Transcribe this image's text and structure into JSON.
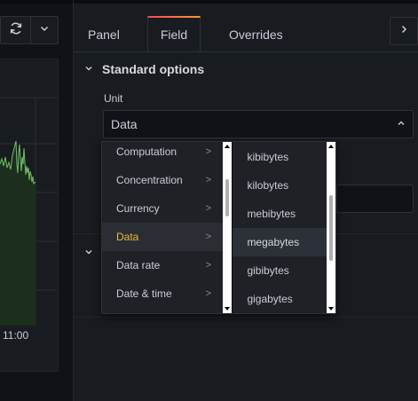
{
  "graph": {
    "time_label": "11:00"
  },
  "tabs": [
    {
      "label": "Panel"
    },
    {
      "label": "Field"
    },
    {
      "label": "Overrides"
    }
  ],
  "section": {
    "title": "Standard options"
  },
  "unit": {
    "label": "Unit",
    "value": "Data"
  },
  "cascader": {
    "categories": [
      {
        "label": "Computation",
        "arrow": ">"
      },
      {
        "label": "Concentration",
        "arrow": ">"
      },
      {
        "label": "Currency",
        "arrow": ">"
      },
      {
        "label": "Data",
        "arrow": ">"
      },
      {
        "label": "Data rate",
        "arrow": ">"
      },
      {
        "label": "Date & time",
        "arrow": ">"
      }
    ],
    "units": [
      {
        "label": "kibibytes"
      },
      {
        "label": "kilobytes"
      },
      {
        "label": "mebibytes"
      },
      {
        "label": "megabytes"
      },
      {
        "label": "gibibytes"
      },
      {
        "label": "gigabytes"
      }
    ]
  },
  "colors": {
    "active_text": "#eab839",
    "background": "#111217",
    "panel": "#181b1f",
    "graph_line": "#73bf69"
  },
  "icons": {
    "refresh": "refresh-icon",
    "dropdown": "chevron-down-icon",
    "expand": "chevron-right-icon",
    "select_open": "chevron-up-icon",
    "section_toggle": "chevron-down-icon"
  }
}
